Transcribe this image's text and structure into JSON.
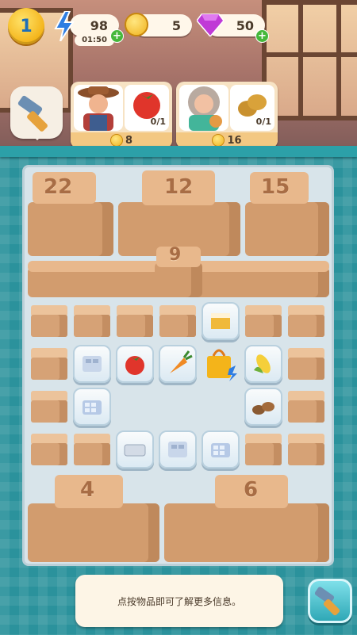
{
  "top_bar": {
    "level": "1",
    "energy": {
      "value": "98",
      "timer": "01:50",
      "icon": "lightning-icon"
    },
    "coins": {
      "value": "5",
      "icon": "coin-icon"
    },
    "gems": {
      "value": "50",
      "icon": "gem-icon"
    },
    "plus_label": "+"
  },
  "orders": [
    {
      "customer": "farmer",
      "item_icon": "tomato-icon",
      "progress": "0/1",
      "reward": "8"
    },
    {
      "customer": "nurse",
      "item_icon": "potato-icon",
      "progress": "0/1",
      "reward": "16"
    }
  ],
  "board": {
    "big_boxes": [
      "22",
      "12",
      "15",
      "9",
      "4",
      "6"
    ],
    "items": [
      {
        "name": "cake-slice-item",
        "icon": "cake-icon"
      },
      {
        "name": "ice-tray-item",
        "icon": "ice-tray-icon"
      },
      {
        "name": "tomato-item",
        "icon": "tomato-icon"
      },
      {
        "name": "carrot-item",
        "icon": "carrot-icon"
      },
      {
        "name": "gift-bag-item",
        "icon": "gift-bag-icon"
      },
      {
        "name": "corn-item",
        "icon": "corn-icon"
      },
      {
        "name": "ice-cube-tray-item",
        "icon": "ice-cube-icon"
      },
      {
        "name": "nuts-item",
        "icon": "nuts-icon"
      },
      {
        "name": "tray-item",
        "icon": "tray-icon"
      },
      {
        "name": "ice-tray-2-item",
        "icon": "ice-tray-icon"
      },
      {
        "name": "ice-cube-tray-2-item",
        "icon": "ice-cube-icon"
      }
    ]
  },
  "hint_text": "点按物品即可了解更多信息。",
  "colors": {
    "accent": "#2b929c",
    "coin": "#f0b21e",
    "gem": "#c03ad6"
  }
}
